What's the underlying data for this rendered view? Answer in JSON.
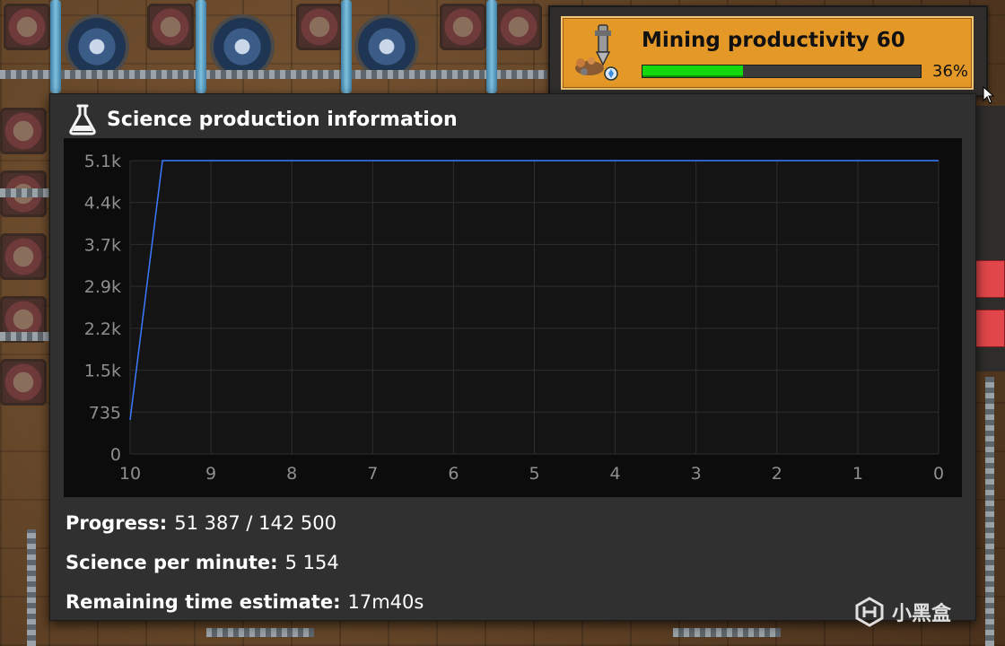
{
  "research": {
    "title": "Mining productivity 60",
    "progress_fraction": 0.36,
    "progress_text": "36%",
    "icon": "mining-drill-icon",
    "bar_color": "#14d80e",
    "banner_color": "#e39827"
  },
  "science_window": {
    "title": "Science production information",
    "icon": "flask-icon",
    "stats": [
      {
        "label": "Progress:",
        "value": "51 387 / 142 500"
      },
      {
        "label": "Science per minute:",
        "value": "5 154"
      },
      {
        "label": "Remaining time estimate:",
        "value": "17m40s"
      }
    ]
  },
  "chart_data": {
    "type": "line",
    "title": "",
    "xlabel": "",
    "ylabel": "",
    "x_ticks": [
      "10",
      "9",
      "8",
      "7",
      "6",
      "5",
      "4",
      "3",
      "2",
      "1",
      "0"
    ],
    "y_ticks": [
      "0",
      "735",
      "1.5k",
      "2.2k",
      "2.9k",
      "3.7k",
      "4.4k",
      "5.1k"
    ],
    "xlim": [
      10,
      0
    ],
    "ylim": [
      0,
      5154
    ],
    "grid": true,
    "series": [
      {
        "color": "#3a7bff",
        "x": [
          10,
          9.6,
          0
        ],
        "y": [
          600,
          5154,
          5154
        ]
      }
    ]
  },
  "watermark": {
    "text": "小黑盒"
  }
}
